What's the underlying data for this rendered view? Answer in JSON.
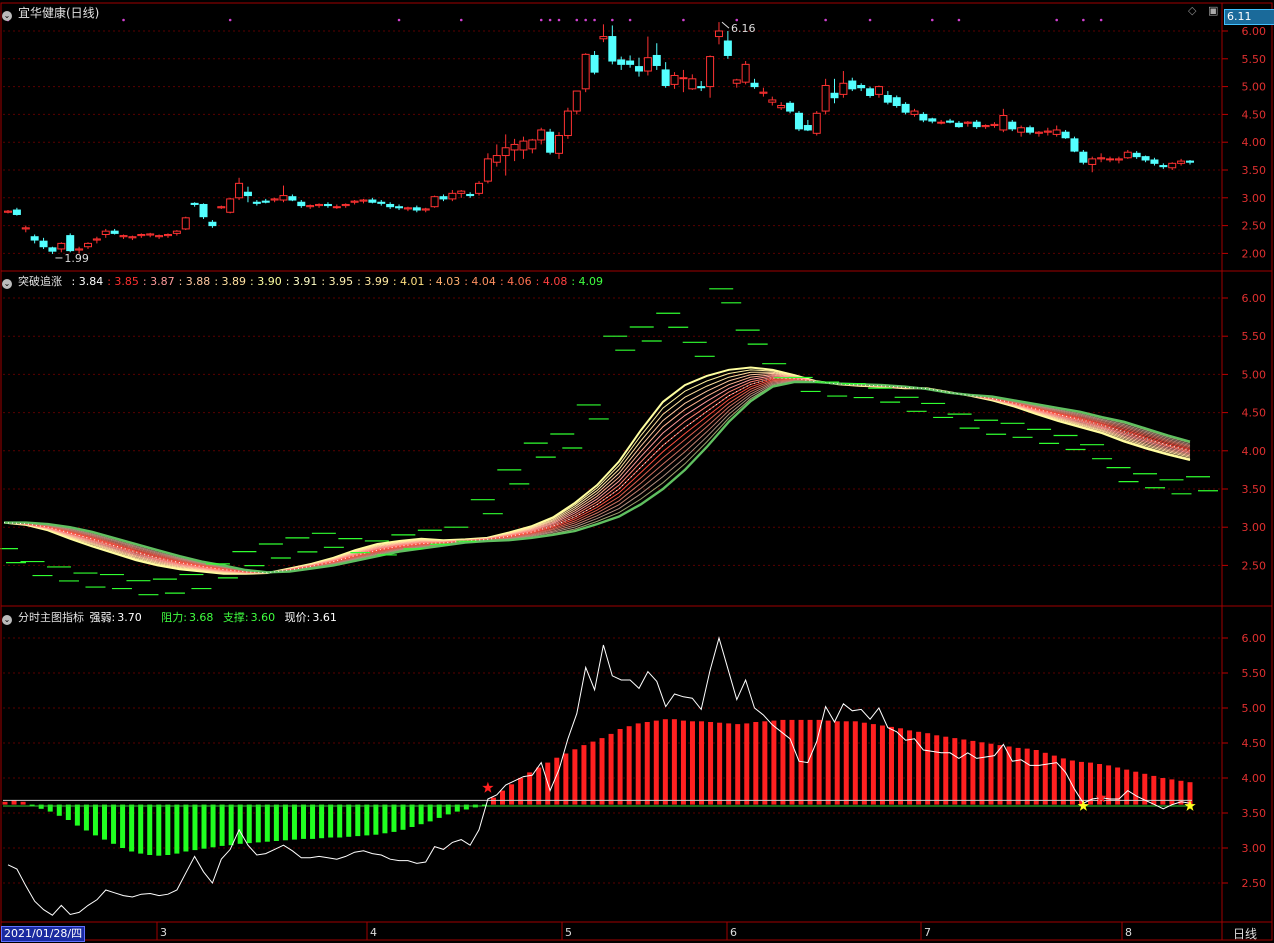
{
  "panel1": {
    "title": "宜华健康(日线)",
    "price_tag": "6.11",
    "high_label": "6.16",
    "low_label": "1.99",
    "yticks": [
      "6.00",
      "5.50",
      "5.00",
      "4.50",
      "4.00",
      "3.50",
      "3.00",
      "2.50",
      "2.00"
    ]
  },
  "panel2": {
    "title": "突破追涨",
    "values": [
      {
        "v": "3.84",
        "c": "#ffffff"
      },
      {
        "v": "3.85",
        "c": "#ff3030"
      },
      {
        "v": "3.87",
        "c": "#ff9a9a"
      },
      {
        "v": "3.88",
        "c": "#ffc8a0"
      },
      {
        "v": "3.89",
        "c": "#ffe0a0"
      },
      {
        "v": "3.90",
        "c": "#ffffa0"
      },
      {
        "v": "3.91",
        "c": "#ffffc8"
      },
      {
        "v": "3.95",
        "c": "#fff0b0"
      },
      {
        "v": "3.99",
        "c": "#ffe8a0"
      },
      {
        "v": "4.01",
        "c": "#ffe080"
      },
      {
        "v": "4.03",
        "c": "#ffb070"
      },
      {
        "v": "4.04",
        "c": "#ff9060"
      },
      {
        "v": "4.06",
        "c": "#ff7050"
      },
      {
        "v": "4.08",
        "c": "#ff4040"
      },
      {
        "v": "4.09",
        "c": "#40ff40"
      }
    ],
    "yticks": [
      "6.00",
      "5.50",
      "5.00",
      "4.50",
      "4.00",
      "3.50",
      "3.00",
      "2.50"
    ]
  },
  "panel3": {
    "title": "分时主图指标",
    "strength_label": "强弱:",
    "strength_value": "3.70",
    "resist_label": "阻力:",
    "resist_value": "3.68",
    "support_label": "支撑:",
    "support_value": "3.60",
    "price_label": "现价:",
    "price_value": "3.61",
    "yticks": [
      "6.00",
      "5.50",
      "5.00",
      "4.50",
      "4.00",
      "3.50",
      "3.00",
      "2.50"
    ]
  },
  "xaxis": {
    "start_date": "2021/01/28/四",
    "months": [
      "3",
      "4",
      "5",
      "6",
      "7",
      "8"
    ],
    "period_button": "日线"
  },
  "chart_data": [
    {
      "type": "candlestick",
      "title": "宜华健康(日线)",
      "ylim": [
        1.75,
        6.25
      ],
      "y_axis_side": "right",
      "grid": "dotted horizontal",
      "candles": [
        [
          2.74,
          2.78,
          2.72,
          2.76
        ],
        [
          2.78,
          2.82,
          2.68,
          2.7
        ],
        [
          2.44,
          2.5,
          2.38,
          2.46
        ],
        [
          2.3,
          2.34,
          2.18,
          2.24
        ],
        [
          2.22,
          2.28,
          2.08,
          2.12
        ],
        [
          2.1,
          2.12,
          1.99,
          2.04
        ],
        [
          2.08,
          2.2,
          2.02,
          2.18
        ],
        [
          2.32,
          2.36,
          2.02,
          2.05
        ],
        [
          2.06,
          2.12,
          2.0,
          2.08
        ],
        [
          2.12,
          2.2,
          2.08,
          2.18
        ],
        [
          2.24,
          2.3,
          2.18,
          2.26
        ],
        [
          2.34,
          2.44,
          2.28,
          2.4
        ],
        [
          2.4,
          2.44,
          2.34,
          2.36
        ],
        [
          2.3,
          2.34,
          2.26,
          2.32
        ],
        [
          2.28,
          2.32,
          2.24,
          2.3
        ],
        [
          2.32,
          2.36,
          2.28,
          2.34
        ],
        [
          2.33,
          2.37,
          2.29,
          2.35
        ],
        [
          2.3,
          2.34,
          2.26,
          2.32
        ],
        [
          2.32,
          2.36,
          2.28,
          2.34
        ],
        [
          2.36,
          2.42,
          2.32,
          2.4
        ],
        [
          2.44,
          2.66,
          2.42,
          2.64
        ],
        [
          2.9,
          2.92,
          2.84,
          2.88
        ],
        [
          2.88,
          2.9,
          2.62,
          2.66
        ],
        [
          2.56,
          2.6,
          2.46,
          2.5
        ],
        [
          2.82,
          2.86,
          2.8,
          2.84
        ],
        [
          2.74,
          3.0,
          2.72,
          2.98
        ],
        [
          3.0,
          3.36,
          2.96,
          3.26
        ],
        [
          3.1,
          3.2,
          2.92,
          3.04
        ],
        [
          2.92,
          2.96,
          2.86,
          2.9
        ],
        [
          2.94,
          2.98,
          2.9,
          2.92
        ],
        [
          2.96,
          3.0,
          2.92,
          2.98
        ],
        [
          2.96,
          3.22,
          2.92,
          3.04
        ],
        [
          3.02,
          3.06,
          2.94,
          2.96
        ],
        [
          2.92,
          2.96,
          2.82,
          2.86
        ],
        [
          2.84,
          2.88,
          2.8,
          2.86
        ],
        [
          2.86,
          2.9,
          2.82,
          2.88
        ],
        [
          2.88,
          2.92,
          2.82,
          2.86
        ],
        [
          2.84,
          2.88,
          2.8,
          2.84
        ],
        [
          2.86,
          2.9,
          2.82,
          2.88
        ],
        [
          2.92,
          2.96,
          2.88,
          2.94
        ],
        [
          2.94,
          2.98,
          2.9,
          2.96
        ],
        [
          2.96,
          3.0,
          2.9,
          2.92
        ],
        [
          2.92,
          2.96,
          2.86,
          2.9
        ],
        [
          2.88,
          2.92,
          2.8,
          2.84
        ],
        [
          2.84,
          2.88,
          2.78,
          2.82
        ],
        [
          2.8,
          2.84,
          2.76,
          2.82
        ],
        [
          2.82,
          2.86,
          2.74,
          2.78
        ],
        [
          2.78,
          2.82,
          2.74,
          2.8
        ],
        [
          2.84,
          3.04,
          2.82,
          3.02
        ],
        [
          3.02,
          3.06,
          2.94,
          2.98
        ],
        [
          2.98,
          3.14,
          2.94,
          3.08
        ],
        [
          3.08,
          3.14,
          3.0,
          3.12
        ],
        [
          3.06,
          3.1,
          3.0,
          3.04
        ],
        [
          3.08,
          3.3,
          3.04,
          3.26
        ],
        [
          3.3,
          3.8,
          3.26,
          3.7
        ],
        [
          3.64,
          3.96,
          3.56,
          3.76
        ],
        [
          3.76,
          4.14,
          3.4,
          3.9
        ],
        [
          3.86,
          4.06,
          3.66,
          3.96
        ],
        [
          3.86,
          4.1,
          3.7,
          4.02
        ],
        [
          3.88,
          4.06,
          3.8,
          4.04
        ],
        [
          4.04,
          4.26,
          3.96,
          4.22
        ],
        [
          4.18,
          4.24,
          3.78,
          3.82
        ],
        [
          3.8,
          4.18,
          3.7,
          4.12
        ],
        [
          4.12,
          4.62,
          4.06,
          4.56
        ],
        [
          4.56,
          4.9,
          4.5,
          4.92
        ],
        [
          4.96,
          5.6,
          4.9,
          5.58
        ],
        [
          5.56,
          5.64,
          5.22,
          5.26
        ],
        [
          5.86,
          6.12,
          5.8,
          5.9
        ],
        [
          5.9,
          6.1,
          5.4,
          5.46
        ],
        [
          5.48,
          5.54,
          5.3,
          5.4
        ],
        [
          5.46,
          5.56,
          5.34,
          5.4
        ],
        [
          5.36,
          5.52,
          5.18,
          5.28
        ],
        [
          5.28,
          5.9,
          5.2,
          5.52
        ],
        [
          5.56,
          5.78,
          5.3,
          5.38
        ],
        [
          5.3,
          5.44,
          4.98,
          5.02
        ],
        [
          5.04,
          5.26,
          4.96,
          5.2
        ],
        [
          5.16,
          5.3,
          4.9,
          5.16
        ],
        [
          4.96,
          5.22,
          4.94,
          5.14
        ],
        [
          5.0,
          5.1,
          4.92,
          4.98
        ],
        [
          5.0,
          5.56,
          4.8,
          5.54
        ],
        [
          5.9,
          6.16,
          5.76,
          6.0
        ],
        [
          5.82,
          6.0,
          5.5,
          5.56
        ],
        [
          5.06,
          5.14,
          4.98,
          5.12
        ],
        [
          5.08,
          5.46,
          5.04,
          5.4
        ],
        [
          5.06,
          5.14,
          4.96,
          5.0
        ],
        [
          4.88,
          4.98,
          4.82,
          4.9
        ],
        [
          4.72,
          4.82,
          4.66,
          4.76
        ],
        [
          4.62,
          4.72,
          4.58,
          4.66
        ],
        [
          4.7,
          4.74,
          4.52,
          4.56
        ],
        [
          4.52,
          4.56,
          4.2,
          4.24
        ],
        [
          4.3,
          4.4,
          4.2,
          4.22
        ],
        [
          4.16,
          4.56,
          4.12,
          4.52
        ],
        [
          4.56,
          5.14,
          4.5,
          5.02
        ],
        [
          4.88,
          5.14,
          4.7,
          4.8
        ],
        [
          4.86,
          5.28,
          4.8,
          5.06
        ],
        [
          5.1,
          5.16,
          4.92,
          4.96
        ],
        [
          5.02,
          5.06,
          4.92,
          4.98
        ],
        [
          4.96,
          5.0,
          4.8,
          4.84
        ],
        [
          4.86,
          5.02,
          4.8,
          5.0
        ],
        [
          4.84,
          4.92,
          4.68,
          4.72
        ],
        [
          4.8,
          4.84,
          4.62,
          4.66
        ],
        [
          4.68,
          4.72,
          4.5,
          4.54
        ],
        [
          4.5,
          4.6,
          4.46,
          4.56
        ],
        [
          4.5,
          4.54,
          4.36,
          4.4
        ],
        [
          4.42,
          4.44,
          4.34,
          4.38
        ],
        [
          4.36,
          4.4,
          4.32,
          4.36
        ],
        [
          4.38,
          4.42,
          4.34,
          4.36
        ],
        [
          4.34,
          4.38,
          4.26,
          4.28
        ],
        [
          4.34,
          4.38,
          4.28,
          4.36
        ],
        [
          4.36,
          4.4,
          4.24,
          4.28
        ],
        [
          4.28,
          4.32,
          4.24,
          4.3
        ],
        [
          4.3,
          4.36,
          4.26,
          4.32
        ],
        [
          4.22,
          4.6,
          4.18,
          4.48
        ],
        [
          4.36,
          4.4,
          4.2,
          4.24
        ],
        [
          4.18,
          4.3,
          4.1,
          4.26
        ],
        [
          4.26,
          4.3,
          4.14,
          4.18
        ],
        [
          4.16,
          4.2,
          4.1,
          4.18
        ],
        [
          4.18,
          4.26,
          4.12,
          4.2
        ],
        [
          4.14,
          4.3,
          4.1,
          4.22
        ],
        [
          4.18,
          4.22,
          4.06,
          4.08
        ],
        [
          4.06,
          4.1,
          3.82,
          3.84
        ],
        [
          3.82,
          3.86,
          3.6,
          3.64
        ],
        [
          3.6,
          3.74,
          3.46,
          3.7
        ],
        [
          3.7,
          3.8,
          3.64,
          3.72
        ],
        [
          3.7,
          3.74,
          3.64,
          3.7
        ],
        [
          3.68,
          3.74,
          3.62,
          3.7
        ],
        [
          3.72,
          3.86,
          3.7,
          3.82
        ],
        [
          3.8,
          3.84,
          3.7,
          3.74
        ],
        [
          3.74,
          3.76,
          3.64,
          3.68
        ],
        [
          3.68,
          3.72,
          3.58,
          3.62
        ],
        [
          3.58,
          3.62,
          3.52,
          3.56
        ],
        [
          3.54,
          3.64,
          3.5,
          3.62
        ],
        [
          3.62,
          3.7,
          3.58,
          3.66
        ],
        [
          3.66,
          3.68,
          3.6,
          3.64
        ]
      ]
    },
    {
      "type": "line",
      "title": "突破追涨",
      "ylim": [
        2.2,
        6.2
      ],
      "series_note": "fan of 15 moving averages drawn as a ribbon plus short horizontal breakout step markers",
      "fast_ma": [
        3.06,
        3.03,
        2.96,
        2.85,
        2.75,
        2.66,
        2.57,
        2.5,
        2.45,
        2.42,
        2.39,
        2.39,
        2.4,
        2.46,
        2.52,
        2.6,
        2.7,
        2.78,
        2.82,
        2.85,
        2.83,
        2.84,
        2.86,
        2.93,
        3.01,
        3.13,
        3.32,
        3.55,
        3.86,
        4.27,
        4.64,
        4.86,
        4.98,
        5.06,
        5.09,
        5.06,
        4.99,
        4.91,
        4.87,
        4.85,
        4.84,
        4.82,
        4.82,
        4.77,
        4.72,
        4.66,
        4.58,
        4.48,
        4.39,
        4.31,
        4.23,
        4.12,
        4.03,
        3.95,
        3.88
      ],
      "slow_ma": [
        3.06,
        3.06,
        3.04,
        3.0,
        2.94,
        2.86,
        2.78,
        2.7,
        2.62,
        2.55,
        2.5,
        2.44,
        2.41,
        2.42,
        2.46,
        2.5,
        2.56,
        2.62,
        2.68,
        2.72,
        2.76,
        2.8,
        2.82,
        2.83,
        2.86,
        2.9,
        2.95,
        3.04,
        3.14,
        3.3,
        3.5,
        3.75,
        4.05,
        4.38,
        4.65,
        4.84,
        4.9,
        4.9,
        4.88,
        4.87,
        4.86,
        4.84,
        4.81,
        4.76,
        4.73,
        4.71,
        4.66,
        4.61,
        4.56,
        4.51,
        4.44,
        4.38,
        4.29,
        4.2,
        4.12
      ],
      "breakout_levels": [
        2.72,
        2.55,
        2.48,
        2.4,
        2.38,
        2.3,
        2.32,
        2.38,
        2.52,
        2.68,
        2.78,
        2.86,
        2.92,
        2.85,
        2.82,
        2.9,
        2.96,
        3.0,
        3.36,
        3.75,
        4.1,
        4.22,
        4.6,
        5.5,
        5.62,
        5.8,
        5.42,
        6.12,
        5.58,
        5.14,
        4.96,
        4.9,
        4.88,
        4.82,
        4.7,
        4.62,
        4.48,
        4.4,
        4.36,
        4.28,
        4.2,
        4.08,
        3.78,
        3.7,
        3.62,
        3.66
      ]
    },
    {
      "type": "bar",
      "title": "分时主图指标",
      "ylim": [
        2.1,
        6.3
      ],
      "baseline": 3.62,
      "resistance_level": 3.68,
      "support_level": 3.6,
      "bar_top_values": [
        3.66,
        3.68,
        3.66,
        3.61,
        3.56,
        3.52,
        3.46,
        3.4,
        3.32,
        3.25,
        3.18,
        3.12,
        3.06,
        3.0,
        2.95,
        2.92,
        2.9,
        2.89,
        2.9,
        2.92,
        2.95,
        2.97,
        2.99,
        3.01,
        3.03,
        3.04,
        3.06,
        3.07,
        3.08,
        3.09,
        3.1,
        3.11,
        3.12,
        3.13,
        3.13,
        3.14,
        3.15,
        3.15,
        3.16,
        3.17,
        3.18,
        3.19,
        3.21,
        3.23,
        3.26,
        3.3,
        3.34,
        3.38,
        3.43,
        3.48,
        3.52,
        3.55,
        3.58,
        3.61,
        3.72,
        3.82,
        3.91,
        4.0,
        4.08,
        4.15,
        4.22,
        4.29,
        4.35,
        4.41,
        4.47,
        4.52,
        4.57,
        4.63,
        4.7,
        4.74,
        4.78,
        4.8,
        4.82,
        4.84,
        4.84,
        4.82,
        4.81,
        4.81,
        4.8,
        4.79,
        4.78,
        4.77,
        4.78,
        4.8,
        4.81,
        4.82,
        4.83,
        4.83,
        4.83,
        4.83,
        4.83,
        4.82,
        4.81,
        4.81,
        4.81,
        4.79,
        4.77,
        4.75,
        4.73,
        4.71,
        4.68,
        4.66,
        4.64,
        4.61,
        4.59,
        4.57,
        4.55,
        4.53,
        4.51,
        4.49,
        4.47,
        4.45,
        4.43,
        4.42,
        4.4,
        4.36,
        4.32,
        4.28,
        4.25,
        4.23,
        4.22,
        4.2,
        4.18,
        4.15,
        4.12,
        4.09,
        4.06,
        4.03,
        4.0,
        3.98,
        3.96,
        3.94
      ],
      "price_line_note": "close price line overlaid in white; star/B markers at signal days"
    }
  ]
}
